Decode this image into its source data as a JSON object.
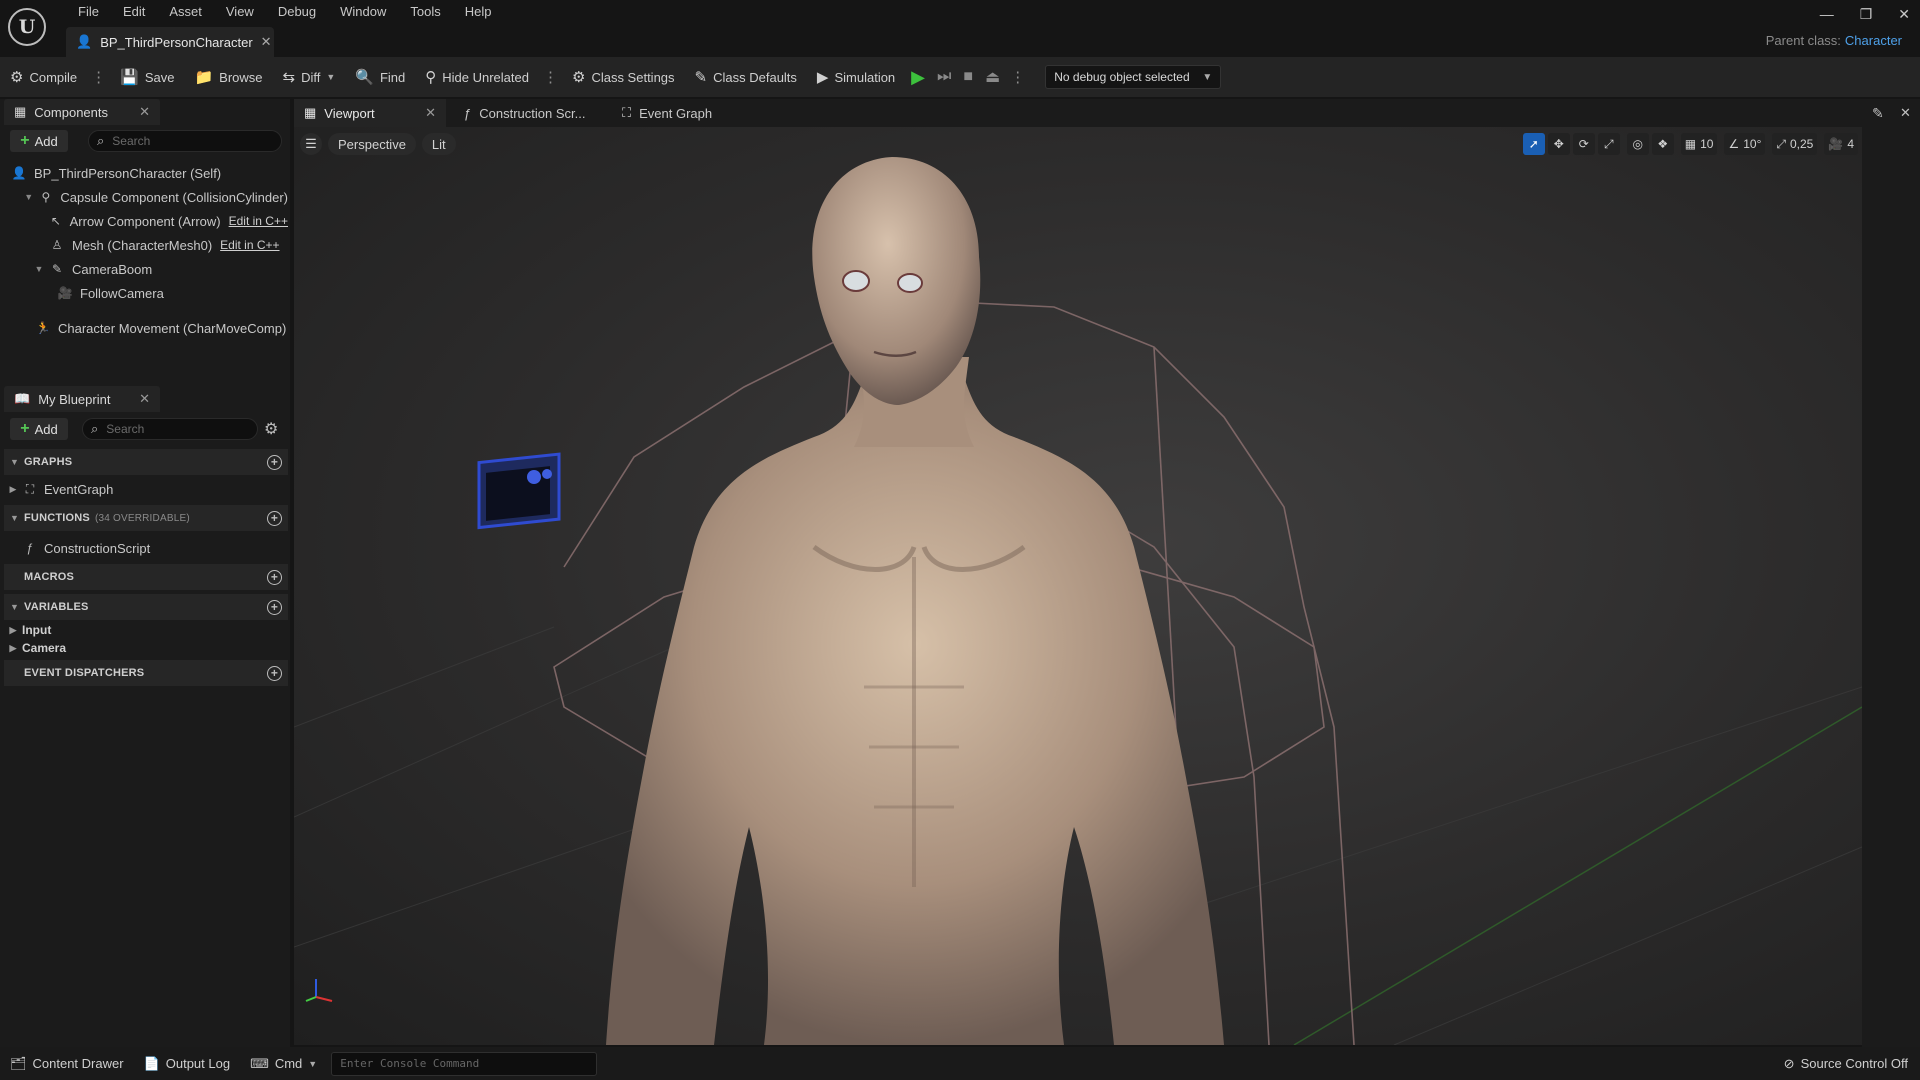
{
  "app": {
    "menu": [
      "File",
      "Edit",
      "Asset",
      "View",
      "Debug",
      "Window",
      "Tools",
      "Help"
    ],
    "document_tab": "BP_ThirdPersonCharacter",
    "parent_class_label": "Parent class:",
    "parent_class_value": "Character",
    "window_controls": [
      "minimize-icon",
      "restore-icon",
      "close-icon"
    ]
  },
  "toolbar": {
    "compile": "Compile",
    "save": "Save",
    "browse": "Browse",
    "diff": "Diff",
    "find": "Find",
    "hide_unrelated": "Hide Unrelated",
    "class_settings": "Class Settings",
    "class_defaults": "Class Defaults",
    "simulation": "Simulation",
    "debug_object": "No debug object selected"
  },
  "components_panel": {
    "title": "Components",
    "add_label": "Add",
    "search_placeholder": "Search",
    "items": [
      {
        "label": "BP_ThirdPersonCharacter (Self)",
        "edit": ""
      },
      {
        "label": "Capsule Component (CollisionCylinder)",
        "edit": ""
      },
      {
        "label": "Arrow Component (Arrow)",
        "edit": "Edit in C++"
      },
      {
        "label": "Mesh (CharacterMesh0)",
        "edit": "Edit in C++"
      },
      {
        "label": "CameraBoom",
        "edit": ""
      },
      {
        "label": "FollowCamera",
        "edit": ""
      },
      {
        "label": "Character Movement (CharMoveComp)",
        "edit": ""
      }
    ]
  },
  "my_blueprint": {
    "title": "My Blueprint",
    "add_label": "Add",
    "search_placeholder": "Search",
    "sections": {
      "graphs": "GRAPHS",
      "functions": "FUNCTIONS",
      "functions_sub": "(34 OVERRIDABLE)",
      "macros": "MACROS",
      "variables": "VARIABLES",
      "event_dispatchers": "EVENT DISPATCHERS"
    },
    "graph_items": [
      "EventGraph"
    ],
    "function_items": [
      "ConstructionScript"
    ],
    "variable_categories": [
      "Input",
      "Camera"
    ]
  },
  "editor_tabs": [
    "Viewport",
    "Construction Scr...",
    "Event Graph"
  ],
  "viewport": {
    "view_mode": "Perspective",
    "lighting": "Lit",
    "grid_snap": "10",
    "rotation_snap": "10°",
    "scale_snap": "0,25",
    "camera_speed": "4"
  },
  "statusbar": {
    "content_drawer": "Content Drawer",
    "output_log": "Output Log",
    "cmd": "Cmd",
    "console_placeholder": "Enter Console Command",
    "source_control": "Source Control Off"
  },
  "colors": {
    "accent_blue": "#1a5fb4",
    "play_green": "#3dc13d",
    "link_blue": "#4ea0e8"
  }
}
